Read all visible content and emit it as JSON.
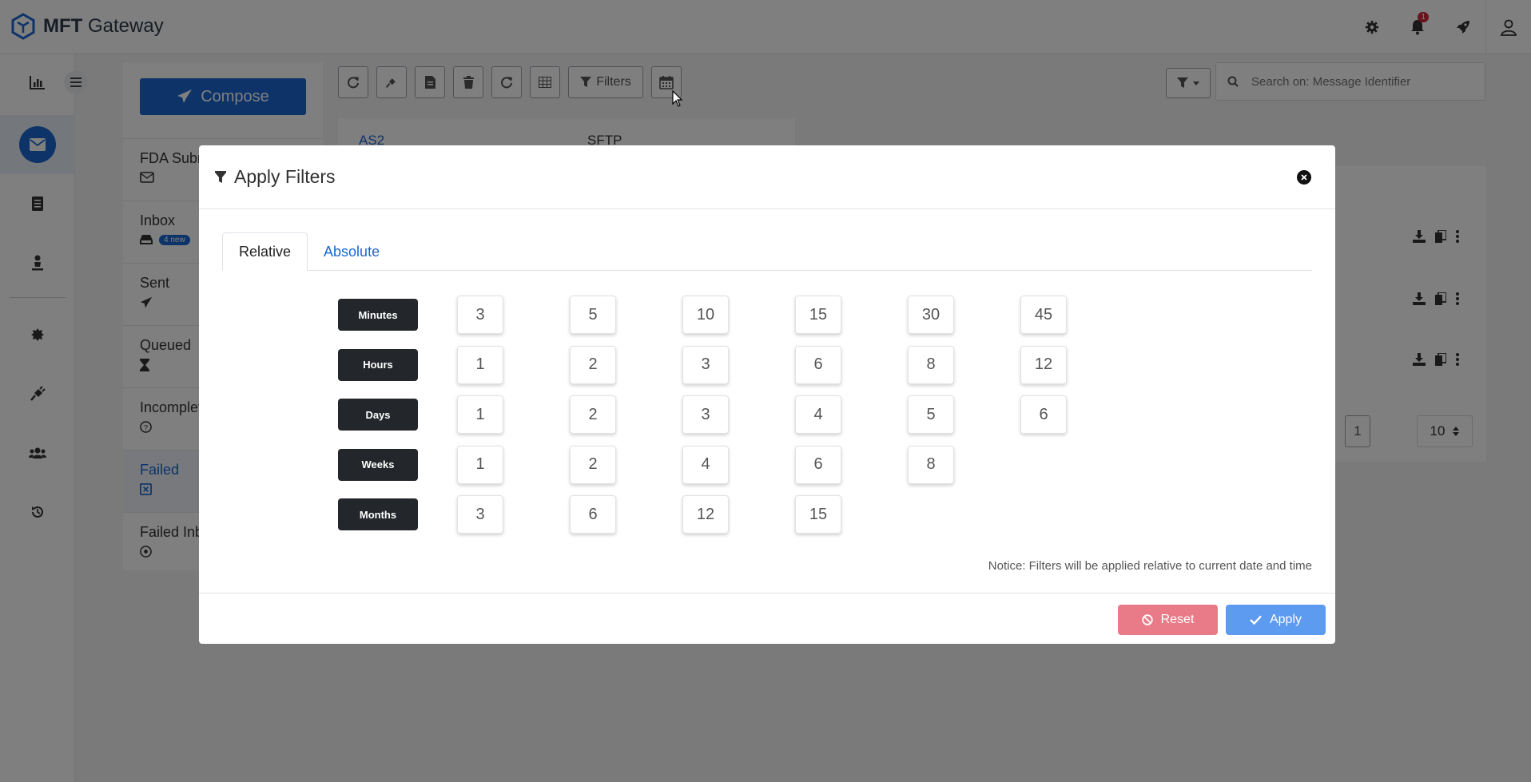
{
  "app": {
    "brand_bold": "MFT",
    "brand_rest": " Gateway",
    "notification_count": "1"
  },
  "colors": {
    "primary": "#1a67d2",
    "danger": "#e97a87",
    "apply": "#5c9bef",
    "dark_label": "#23272b"
  },
  "folders": {
    "compose_label": "Compose",
    "items": [
      {
        "label": "FDA Subm",
        "icon": "envelope-outline-icon"
      },
      {
        "label": "Inbox",
        "icon": "inbox-icon",
        "badge": "4 new"
      },
      {
        "label": "Sent",
        "icon": "paper-plane-icon"
      },
      {
        "label": "Queued",
        "icon": "hourglass-icon"
      },
      {
        "label": "Incomplete",
        "icon": "question-circle-icon"
      },
      {
        "label": "Failed",
        "icon": "x-square-icon"
      },
      {
        "label": "Failed Inb",
        "icon": "clock-circle-icon"
      }
    ]
  },
  "toolbar": {
    "filters_label": "Filters"
  },
  "search": {
    "placeholder": "Search on: Message Identifier"
  },
  "protocol_tabs": [
    "AS2",
    "SFTP"
  ],
  "pager": {
    "page": "1",
    "page_size": "10"
  },
  "modal": {
    "title": "Apply Filters",
    "tabs": {
      "relative": "Relative",
      "absolute": "Absolute"
    },
    "rows": [
      {
        "unit": "Minutes",
        "values": [
          "3",
          "5",
          "10",
          "15",
          "30",
          "45"
        ]
      },
      {
        "unit": "Hours",
        "values": [
          "1",
          "2",
          "3",
          "6",
          "8",
          "12"
        ]
      },
      {
        "unit": "Days",
        "values": [
          "1",
          "2",
          "3",
          "4",
          "5",
          "6"
        ]
      },
      {
        "unit": "Weeks",
        "values": [
          "1",
          "2",
          "4",
          "6",
          "8"
        ]
      },
      {
        "unit": "Months",
        "values": [
          "3",
          "6",
          "12",
          "15"
        ]
      }
    ],
    "notice": "Notice: Filters will be applied relative to current date and time",
    "reset_label": "Reset",
    "apply_label": "Apply"
  }
}
